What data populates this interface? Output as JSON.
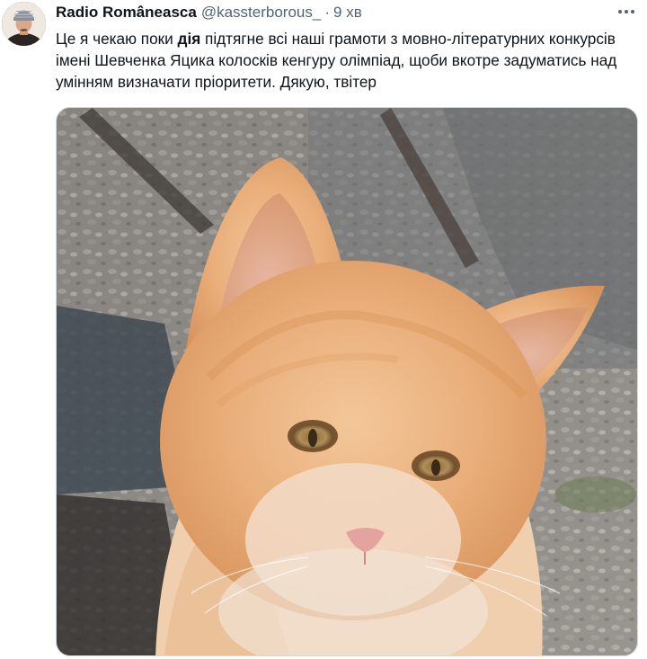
{
  "tweet": {
    "author": {
      "display_name": "Radio Româneasca",
      "handle": "@kassterborous_",
      "avatar_icon": "profile-avatar"
    },
    "separator": "·",
    "timestamp": "9 хв",
    "more_icon": "more-horizontal-icon",
    "text": {
      "before": "Це я чекаю поки ",
      "bold": "дія",
      "after": " підтягне всі наші грамоти з мовно-літературних конкурсів імені Шевченка Яцика колосків кенгуру олімпіад, щоби вкотре задуматись над умінням визначати пріоритети. Дякую, твітер"
    },
    "media": {
      "type": "photo",
      "subject": "orange kitten"
    }
  },
  "colors": {
    "text_primary": "#0f1419",
    "text_secondary": "#536471",
    "border": "#cfd9de"
  }
}
